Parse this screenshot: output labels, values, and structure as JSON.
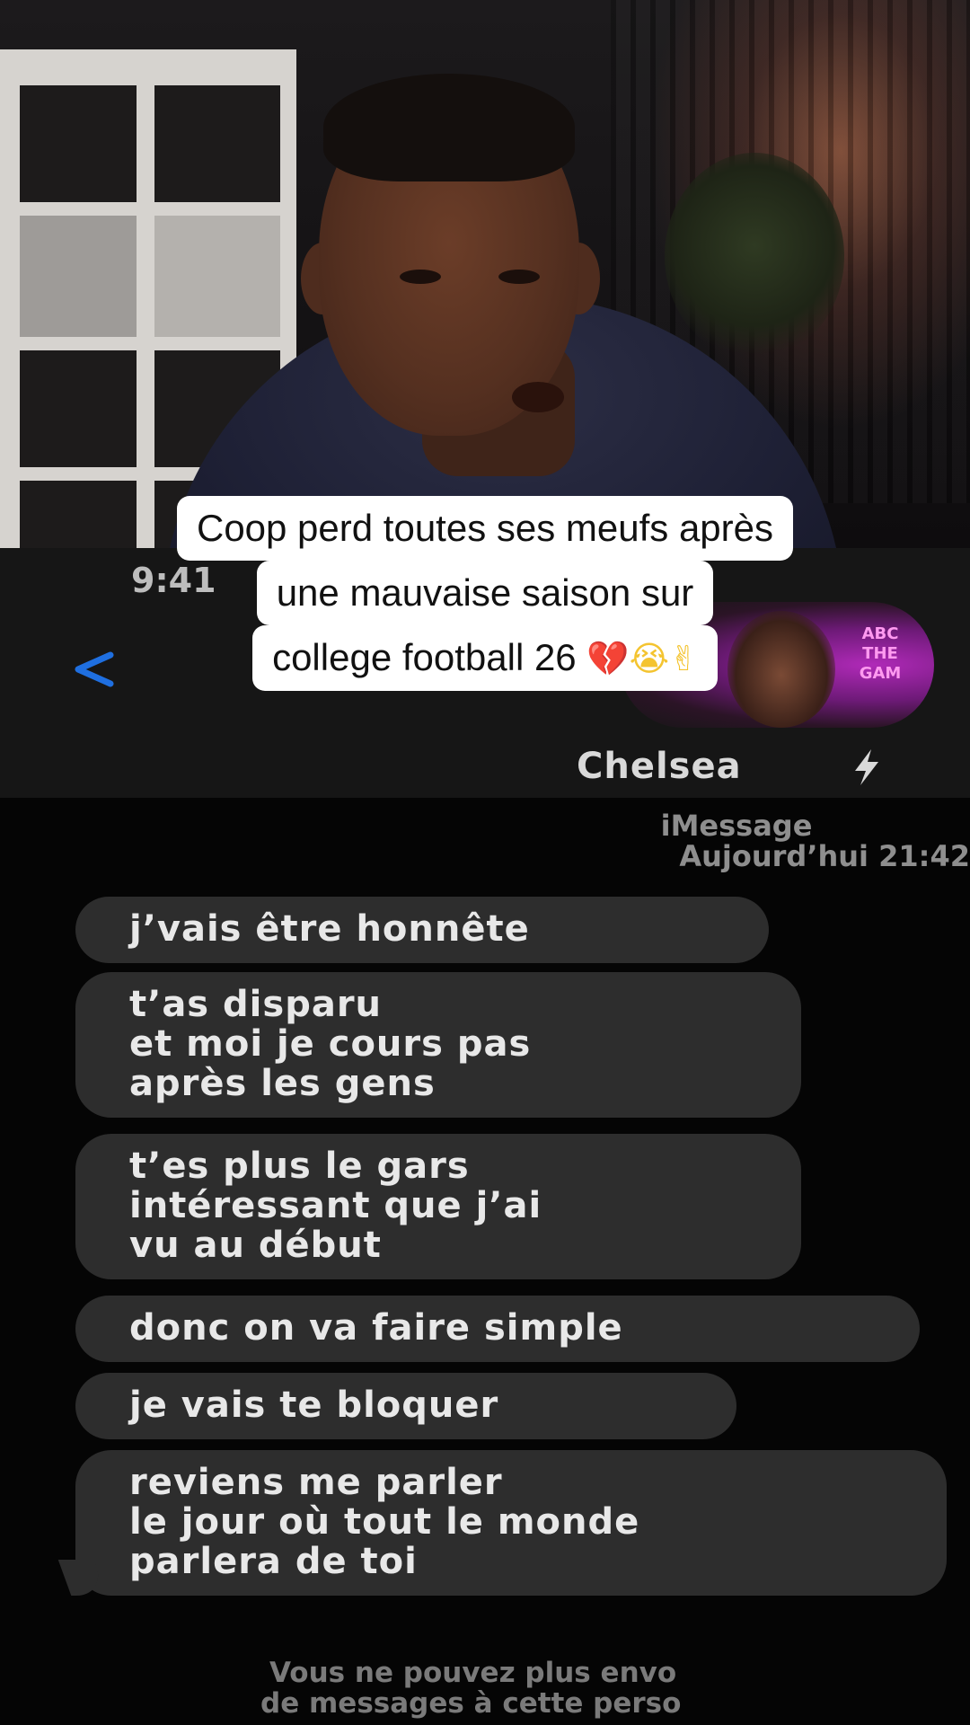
{
  "caption": {
    "line1": "Coop perd toutes ses meufs après",
    "line2": "une mauvaise saison sur",
    "line3_text": "college football 26 ",
    "emoji_1": "💔",
    "emoji_2": "😭",
    "emoji_3": "✌"
  },
  "status_bar": {
    "time": "9:41"
  },
  "header": {
    "back_icon": "chevron-left-icon",
    "contact_name": "Chelsea",
    "contact_badge_icon": "lightning-bolt-icon",
    "avatar_neon_text": "ABC\nTHE\nGAM",
    "accent_color": "#1f6fe0"
  },
  "conversation": {
    "service": "iMessage",
    "timestamp": "Aujourd’hui 21:42",
    "messages": [
      {
        "text": "j’vais être honnête"
      },
      {
        "text": "t’as disparu\net moi je cours pas\naprès les gens"
      },
      {
        "text": "t’es plus le gars\nintéressant que j’ai\nvu au début"
      },
      {
        "text": "donc on va faire simple"
      },
      {
        "text": "je vais te bloquer"
      },
      {
        "text": "reviens me parler\nle jour où tout le monde\nparlera de toi"
      }
    ],
    "bubble_color": "#2d2d2d"
  },
  "footer": {
    "line1": "Vous ne pouvez plus envo",
    "line2": "de messages à cette perso"
  }
}
